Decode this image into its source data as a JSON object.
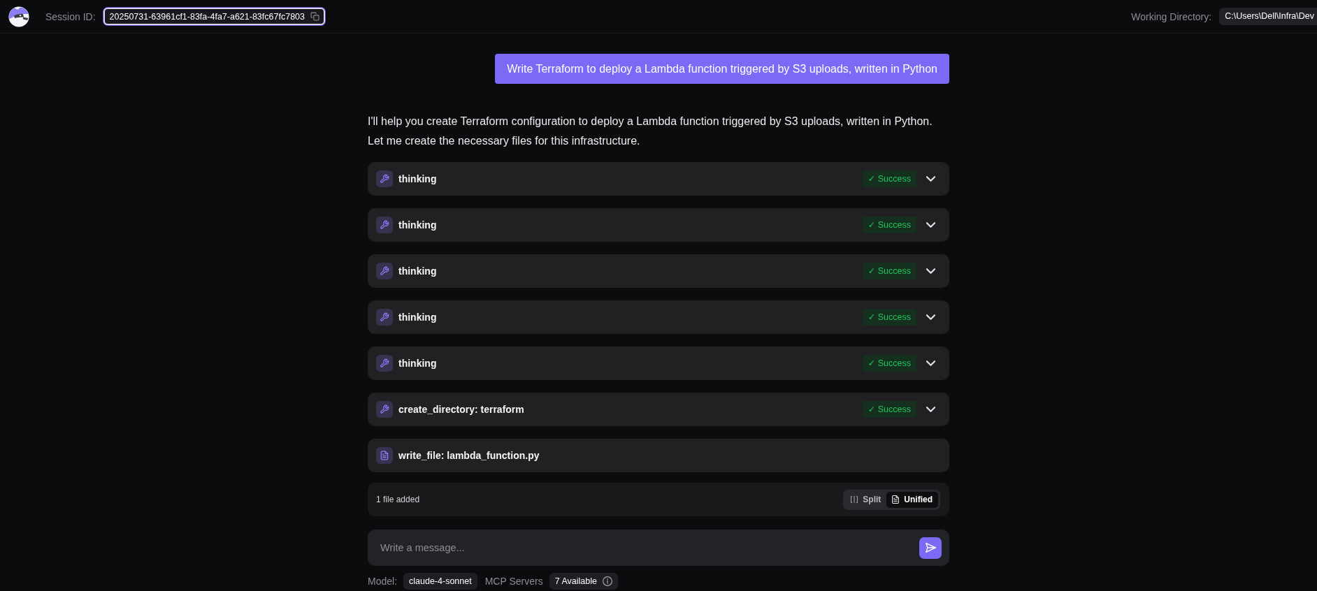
{
  "header": {
    "session_label": "Session ID:",
    "session_id": "20250731-63961cf1-83fa-4fa7-a621-83fc67fc7803",
    "working_directory_label": "Working Directory:",
    "working_directory": "C:\\Users\\Dell\\Infra\\Dev"
  },
  "conversation": {
    "user_message": "Write Terraform to deploy a Lambda function triggered by S3 uploads, written in Python",
    "assistant_message": "I'll help you create Terraform configuration to deploy a Lambda function triggered by S3 uploads, written in Python. Let me create the necessary files for this infrastructure."
  },
  "tool_calls": [
    {
      "kind": "tool",
      "label": "thinking",
      "status": "✓ Success"
    },
    {
      "kind": "tool",
      "label": "thinking",
      "status": "✓ Success"
    },
    {
      "kind": "tool",
      "label": "thinking",
      "status": "✓ Success"
    },
    {
      "kind": "tool",
      "label": "thinking",
      "status": "✓ Success"
    },
    {
      "kind": "tool",
      "label": "thinking",
      "status": "✓ Success"
    },
    {
      "kind": "tool",
      "label": "create_directory: terraform",
      "status": "✓ Success"
    },
    {
      "kind": "file",
      "label": "write_file: lambda_function.py"
    }
  ],
  "diff_panel": {
    "summary": "1 file added",
    "view_modes": [
      {
        "kind": "split",
        "label": "Split",
        "selected": false
      },
      {
        "kind": "unified",
        "label": "Unified",
        "selected": true
      }
    ]
  },
  "composer": {
    "placeholder": "Write a message..."
  },
  "footer": {
    "model_label": "Model:",
    "model": "claude-4-sonnet",
    "mcp_label": "MCP Servers",
    "mcp_status": "7 Available"
  }
}
